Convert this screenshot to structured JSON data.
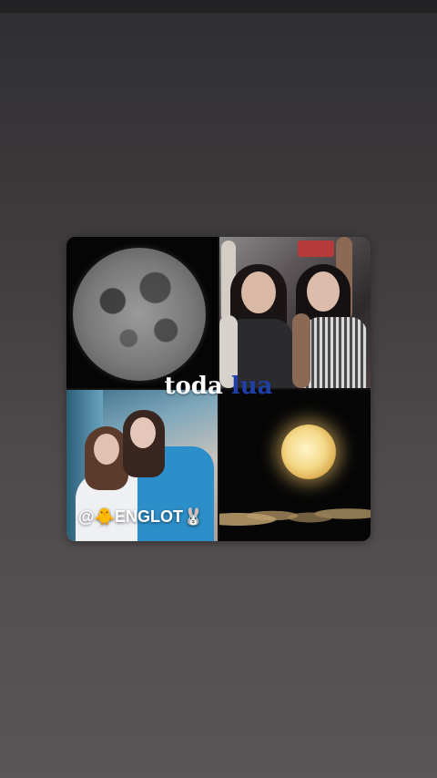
{
  "overlay": {
    "title_part1": "toda",
    "title_part2": "lua"
  },
  "watermark": {
    "text": "@🐥ENGLOT🐰"
  },
  "colors": {
    "background_top": "#2e2e31",
    "background_bottom": "#5a5557",
    "title_white": "#ffffff",
    "title_blue": "#1f3fa8"
  },
  "collage": {
    "tiles": [
      {
        "icon": "full-moon-photo"
      },
      {
        "icon": "two-women-photo"
      },
      {
        "icon": "couple-dancing-photo"
      },
      {
        "icon": "glowing-moon-clouds-photo"
      }
    ]
  }
}
